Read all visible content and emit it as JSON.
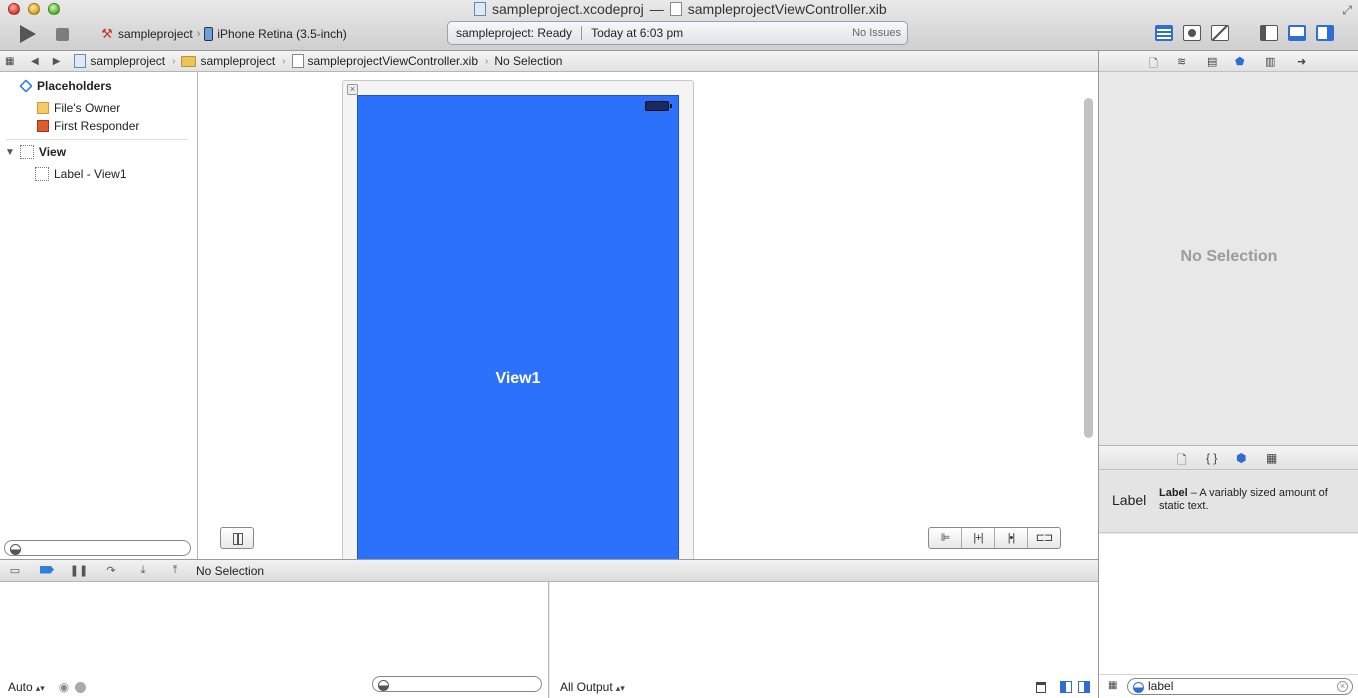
{
  "window": {
    "project_file": "sampleproject.xcodeproj",
    "dash": "—",
    "document_file": "sampleprojectViewController.xib"
  },
  "toolbar": {
    "scheme": "sampleproject",
    "destination": "iPhone Retina (3.5-inch)",
    "activity_status": "sampleproject: Ready",
    "activity_time": "Today at 6:03 pm",
    "activity_issues": "No Issues"
  },
  "jumpbar": {
    "crumbs": [
      "sampleproject",
      "sampleproject",
      "sampleprojectViewController.xib",
      "No Selection"
    ]
  },
  "outline": {
    "placeholders_label": "Placeholders",
    "files_owner": "File's Owner",
    "first_responder": "First Responder",
    "view_label": "View",
    "label_item": "Label - View1"
  },
  "canvas": {
    "view_label": "View1",
    "view_color": "#2b71fb",
    "close_glyph": "×",
    "layout_buttons": [
      "⊫",
      "|+|",
      "|•|",
      "⊏⊐"
    ]
  },
  "debug": {
    "status": "No Selection",
    "variables_popup": "Auto",
    "console_popup": "All Output"
  },
  "inspector": {
    "no_selection": "No Selection"
  },
  "library": {
    "item_thumb": "Label",
    "item_title": "Label",
    "item_desc": " – A variably sized amount of static text.",
    "filter_value": "label"
  }
}
